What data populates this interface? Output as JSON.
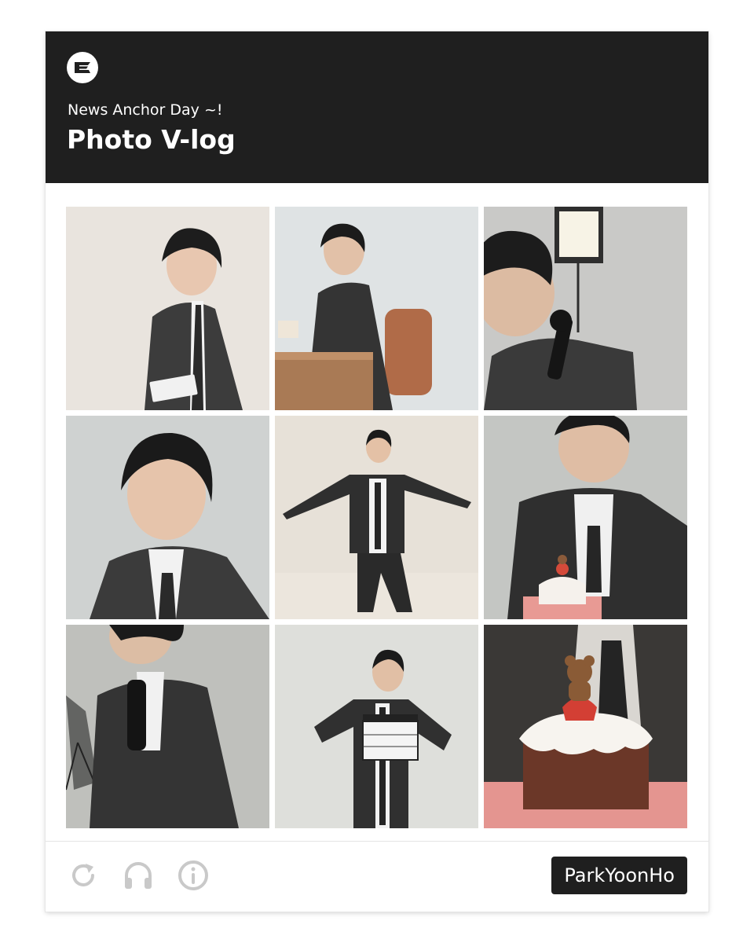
{
  "header": {
    "subtitle": "News Anchor Day ~!",
    "title": "Photo V-log",
    "logo_icon": "brand-e-logo-icon"
  },
  "photos": [
    {
      "description": "photo-1"
    },
    {
      "description": "photo-2"
    },
    {
      "description": "photo-3"
    },
    {
      "description": "photo-4"
    },
    {
      "description": "photo-5"
    },
    {
      "description": "photo-6"
    },
    {
      "description": "photo-7"
    },
    {
      "description": "photo-8"
    },
    {
      "description": "photo-9"
    }
  ],
  "footer": {
    "icons": [
      "refresh-icon",
      "headphones-icon",
      "info-icon"
    ],
    "tag_label": "ParkYoonHo"
  },
  "colors": {
    "header_bg": "#1f1f1f",
    "tag_bg": "#1f1f1f",
    "icon_gray": "#c9c9c9"
  }
}
